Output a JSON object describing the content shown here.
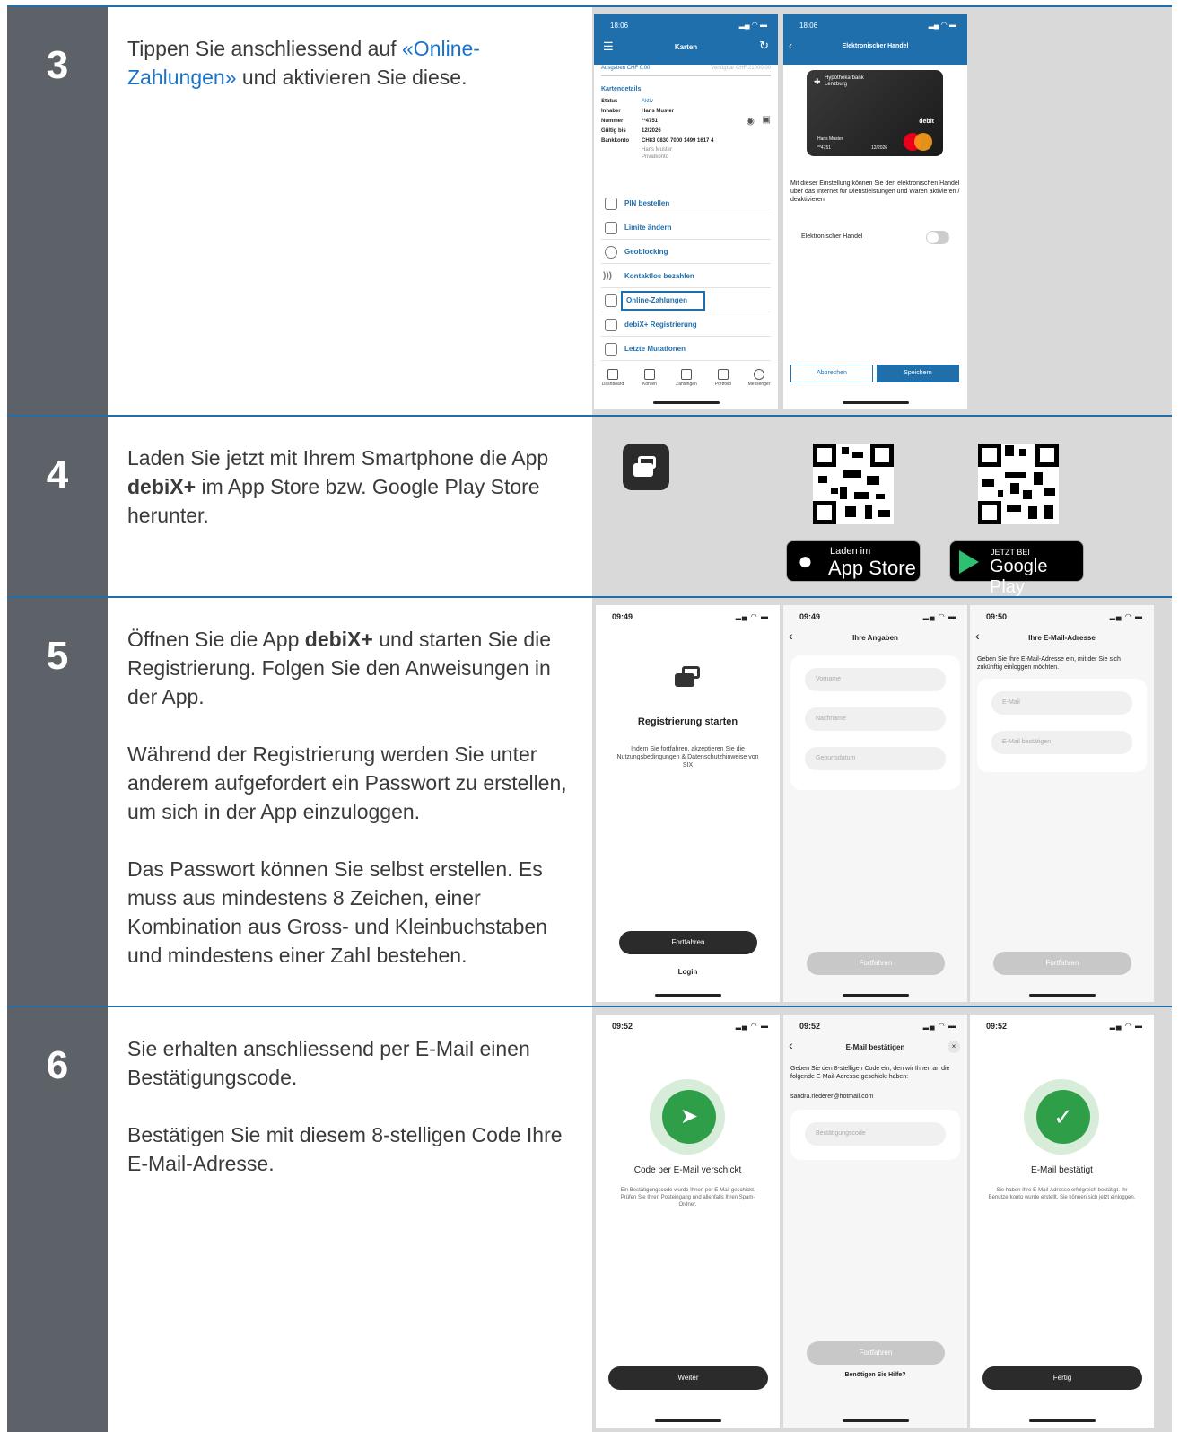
{
  "steps": [
    {
      "number": "3",
      "text_before": "Tippen Sie anschliessend auf ",
      "text_link": "«Online-Zahlungen»",
      "text_after": " und aktivieren Sie diese."
    },
    {
      "number": "4",
      "text_before": "Laden Sie jetzt mit Ihrem Smartphone die App ",
      "text_bold": "debiX+",
      "text_after": " im App Store bzw. Google Play Store herunter."
    },
    {
      "number": "5",
      "p1_before": "Öffnen Sie die App ",
      "p1_bold": "debiX+",
      "p1_after": " und starten Sie die Registrierung. Folgen Sie den Anweisungen in der App.",
      "p2": "Während der Registrierung werden Sie unter anderem aufgefordert ein Passwort zu erstellen, um sich in der App einzuloggen.",
      "p3": "Das Passwort können Sie selbst erstellen. Es muss aus mindestens 8 Zeichen, einer Kombination aus Gross- und Kleinbuchstaben und mindestens einer Zahl bestehen."
    },
    {
      "number": "6",
      "p1": "Sie erhalten anschliessend per E-Mail einen Bestätigungscode.",
      "p2": "Bestätigen Sie mit diesem 8-stelligen Code Ihre E-Mail-Adresse."
    }
  ],
  "s3": {
    "phone1": {
      "time": "18:06",
      "title": "Karten",
      "spent": "Ausgaben CHF 0.00",
      "available": "Verfügbar CHF 21000.00",
      "details_title": "Kartendetails",
      "details": [
        [
          "Status",
          "Aktiv"
        ],
        [
          "Inhaber",
          "Hans Muster"
        ],
        [
          "Nummer",
          "**4751"
        ],
        [
          "Gültig bis",
          "12/2026"
        ],
        [
          "Bankkonto",
          "CH83 0830 7000 1499 1617 4"
        ]
      ],
      "bank_extra1": "Hans Muster",
      "bank_extra2": "Privatkonto",
      "menu": [
        "PIN bestellen",
        "Limite ändern",
        "Geoblocking",
        "Kontaktlos bezahlen",
        "Online-Zahlungen",
        "debiX+ Registrierung",
        "Letzte Mutationen"
      ],
      "tabs": [
        "Dashboard",
        "Konten",
        "Zahlungen",
        "Portfolio",
        "Messenger"
      ]
    },
    "phone2": {
      "time": "18:06",
      "title": "Elektronischer Handel",
      "bank": "Hypothekarbank Lenzburg",
      "card_brand": "debit",
      "holder": "Hans Muster",
      "num": "**4751",
      "exp": "12/2026",
      "desc": "Mit dieser Einstellung können Sie den elektronischen Handel über das Internet für Dienstleistungen und Waren aktivieren / deaktivieren.",
      "toggle_label": "Elektronischer Handel",
      "cancel": "Abbrechen",
      "save": "Speichern"
    }
  },
  "s4": {
    "appstore_small": "Laden im",
    "appstore_big": "App Store",
    "gplay_small": "JETZT BEI",
    "gplay_big": "Google Play"
  },
  "s5": {
    "phone1": {
      "time": "09:49",
      "title": "Registrierung starten",
      "desc1": "Indem Sie fortfahren, akzeptieren Sie die",
      "link": "Nutzungsbedingungen & Datenschutzhinweise",
      "desc2": " von SIX",
      "btn": "Fortfahren",
      "login": "Login"
    },
    "phone2": {
      "time": "09:49",
      "title": "Ihre Angaben",
      "f1": "Vorname",
      "f2": "Nachname",
      "f3": "Geburtsdatum",
      "btn": "Fortfahren"
    },
    "phone3": {
      "time": "09:50",
      "title": "Ihre E-Mail-Adresse",
      "desc": "Geben Sie Ihre E-Mail-Adresse ein, mit der Sie sich zukünftig einloggen möchten.",
      "f1": "E-Mail",
      "f2": "E-Mail bestätigen",
      "btn": "Fortfahren"
    }
  },
  "s6": {
    "phone1": {
      "time": "09:52",
      "title": "Code per E-Mail verschickt",
      "desc": "Ein Bestätigungscode wurde Ihnen per E-Mail geschickt. Prüfen Sie Ihren Posteingang und allenfalls Ihren Spam-Ordner.",
      "btn": "Weiter"
    },
    "phone2": {
      "time": "09:52",
      "title": "E-Mail bestätigen",
      "desc": "Geben Sie den 8-stelligen Code ein, den wir Ihnen an die folgende E-Mail-Adresse geschickt haben:",
      "email": "sandra.riederer@hotmail.com",
      "f1": "Bestätigungscode",
      "btn": "Fortfahren",
      "help": "Benötigen Sie Hilfe?"
    },
    "phone3": {
      "time": "09:52",
      "title": "E-Mail bestätigt",
      "desc": "Sie haben Ihre E-Mail-Adresse erfolgreich bestätigt. Ihr Benutzerkonto wurde erstellt. Sie können sich jetzt einloggen.",
      "btn": "Fertig"
    }
  },
  "colors": {
    "accent": "#1f6fad",
    "sidebar": "#5d6268",
    "success": "#2e9e48",
    "dark_button": "#2b2b2b"
  }
}
